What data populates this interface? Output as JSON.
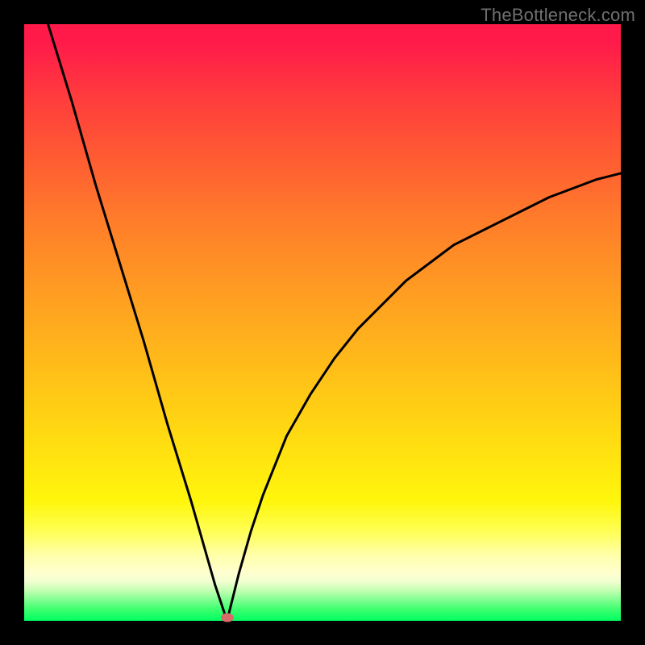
{
  "watermark": "TheBottleneck.com",
  "colors": {
    "frame": "#000000",
    "curve": "#000000",
    "marker": "#d96a6a",
    "gradient_top": "#ff1a4a",
    "gradient_bottom": "#00ff60"
  },
  "chart_data": {
    "type": "line",
    "title": "",
    "xlabel": "",
    "ylabel": "",
    "xlim": [
      0,
      100
    ],
    "ylim": [
      0,
      100
    ],
    "grid": false,
    "legend": false,
    "notes": "V-shaped bottleneck curve on vertical red-to-green gradient; minimum near x≈34, y≈0. Left branch nearly linear from (4,100) to (34,0). Right branch concave rising from (34,0) toward (100,75).",
    "series": [
      {
        "name": "left-branch",
        "x": [
          4,
          8,
          12,
          16,
          20,
          24,
          28,
          32,
          34
        ],
        "y": [
          100,
          87,
          73,
          60,
          47,
          33,
          20,
          6,
          0
        ]
      },
      {
        "name": "right-branch",
        "x": [
          34,
          36,
          38,
          40,
          44,
          48,
          52,
          56,
          60,
          64,
          68,
          72,
          76,
          80,
          84,
          88,
          92,
          96,
          100
        ],
        "y": [
          0,
          8,
          15,
          21,
          31,
          38,
          44,
          49,
          53,
          57,
          60,
          63,
          65,
          67,
          69,
          71,
          72.5,
          74,
          75
        ]
      }
    ],
    "marker": {
      "x": 34,
      "y": 0.5
    }
  }
}
